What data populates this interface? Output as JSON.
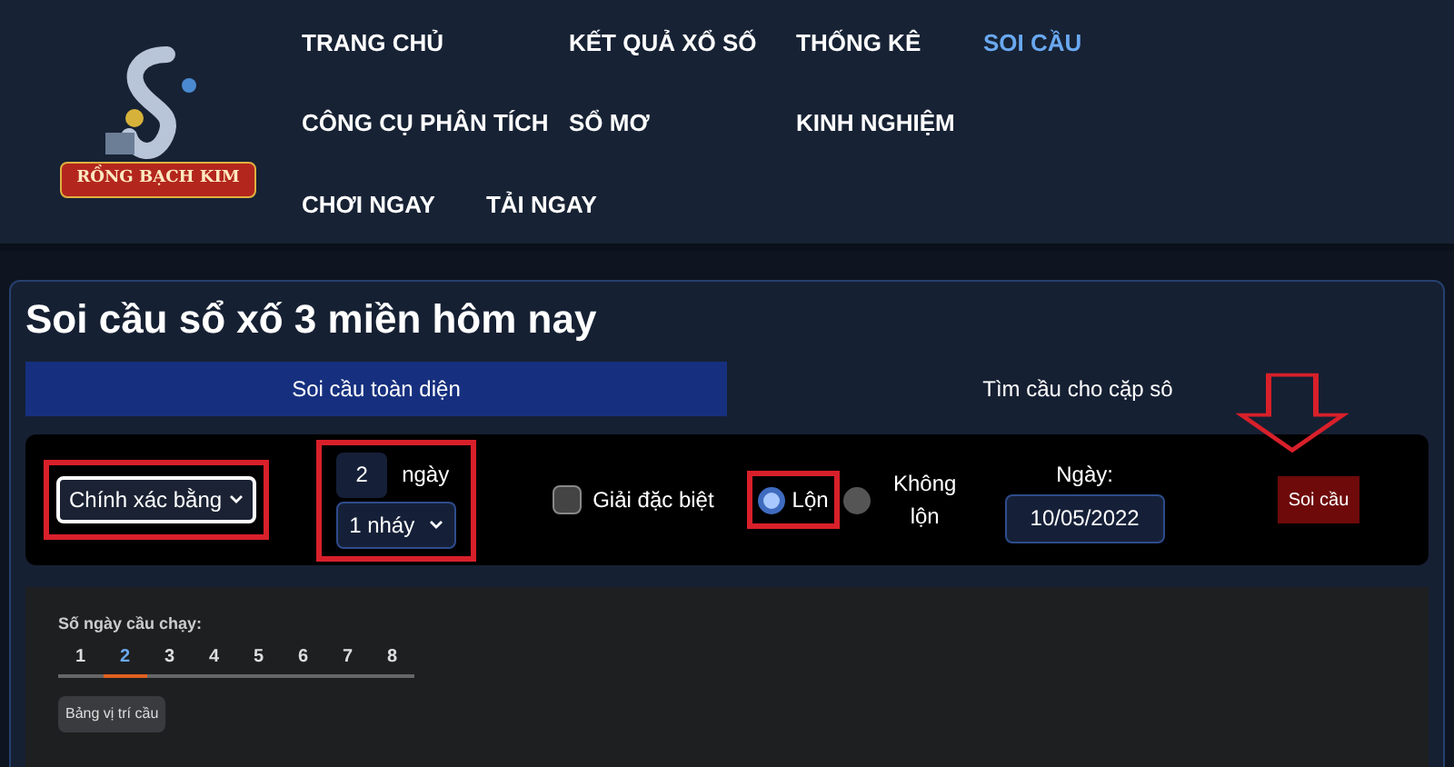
{
  "logo": {
    "text": "RỒNG BẠCH KIM"
  },
  "nav": [
    [
      {
        "label": "TRANG CHỦ",
        "selected": false
      },
      {
        "label": "KẾT QUẢ XỔ SỐ",
        "selected": false
      },
      {
        "label": "THỐNG KÊ",
        "selected": false
      },
      {
        "label": "SOI CẦU",
        "selected": true
      }
    ],
    [
      {
        "label": "CÔNG CỤ PHÂN TÍCH",
        "selected": false
      },
      {
        "label": "SỔ MƠ",
        "selected": false
      },
      {
        "label": "KINH NGHIỆM",
        "selected": false
      }
    ],
    [
      {
        "label": "CHƠI NGAY",
        "selected": false
      },
      {
        "label": "TẢI NGAY",
        "selected": false
      }
    ]
  ],
  "title": "Soi cầu sổ xố 3 miền hôm nay",
  "tabs": [
    {
      "label": "Soi cầu toàn diện",
      "selected": true
    },
    {
      "label": "Tìm cầu cho cặp sô",
      "selected": false
    }
  ],
  "form": {
    "mode": "Chính xác bằng",
    "days_value": "2",
    "days_unit": "ngày",
    "jump": "1 nháy",
    "special": {
      "label": "Giải đặc biệt",
      "checked": false
    },
    "radios": [
      {
        "label": "Lộn",
        "selected": true
      },
      {
        "label": "Không lộn",
        "selected": false
      }
    ],
    "date_label": "Ngày:",
    "date": "10/05/2022",
    "submit": "Soi cầu"
  },
  "run_days": {
    "label": "Số ngày cầu chạy:",
    "days": [
      {
        "label": "1",
        "selected": false
      },
      {
        "label": "2",
        "selected": true
      },
      {
        "label": "3",
        "selected": false
      },
      {
        "label": "4",
        "selected": false
      },
      {
        "label": "5",
        "selected": false
      },
      {
        "label": "6",
        "selected": false
      },
      {
        "label": "7",
        "selected": false
      },
      {
        "label": "8",
        "selected": false
      }
    ],
    "button": "Bảng vị trí cầu"
  }
}
